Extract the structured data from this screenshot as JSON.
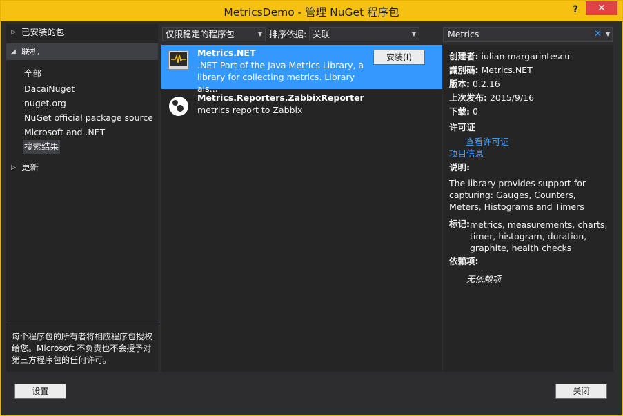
{
  "window": {
    "title": "MetricsDemo - 管理 NuGet 程序包",
    "help_label": "?",
    "close_label": "✕"
  },
  "left": {
    "installed": "已安装的包",
    "online": "联机",
    "online_items": [
      "全部",
      "DacaiNuget",
      "nuget.org",
      "NuGet official package source",
      "Microsoft and .NET",
      "搜索结果"
    ],
    "updates": "更新",
    "footer": "每个程序包的所有者将相应程序包授权给您。Microsoft 不负责也不会授予对第三方程序包的任何许可。"
  },
  "toolbar": {
    "filter_value": "仅限稳定的程序包",
    "sort_label": "排序依据:",
    "sort_value": "关联"
  },
  "packages": [
    {
      "name": "Metrics.NET",
      "description": ".NET Port of the Java Metrics Library, a library for collecting metrics. Library als...",
      "install_label": "安装(I)"
    },
    {
      "name": "Metrics.Reporters.ZabbixReporter",
      "description": "metrics report to Zabbix"
    }
  ],
  "search": {
    "value": "Metrics"
  },
  "details": {
    "creator_label": "创建者:",
    "creator": "iulian.margarintescu",
    "id_label": "識別碼:",
    "id": "Metrics.NET",
    "version_label": "版本:",
    "version": "0.2.16",
    "published_label": "上次发布:",
    "published": "2015/9/16",
    "downloads_label": "下载:",
    "downloads": "0",
    "license_label": "许可证",
    "license_link": "查看许可证",
    "project_link": "项目信息",
    "description_label": "说明:",
    "description": "The library provides support for capturing: Gauges, Counters, Meters, Histograms and Timers",
    "tags_label": "标记:",
    "tags": "metrics, measurements, charts, timer, histogram, duration, graphite, health checks",
    "dependencies_label": "依赖项:",
    "dependencies": "无依赖项"
  },
  "bottom": {
    "settings_label": "设置",
    "close_label": "关闭"
  },
  "colors": {
    "title_bar": "#f5c211",
    "window_bg": "#2d2d30",
    "selection": "#3399ff",
    "close_button": "#e04343"
  }
}
